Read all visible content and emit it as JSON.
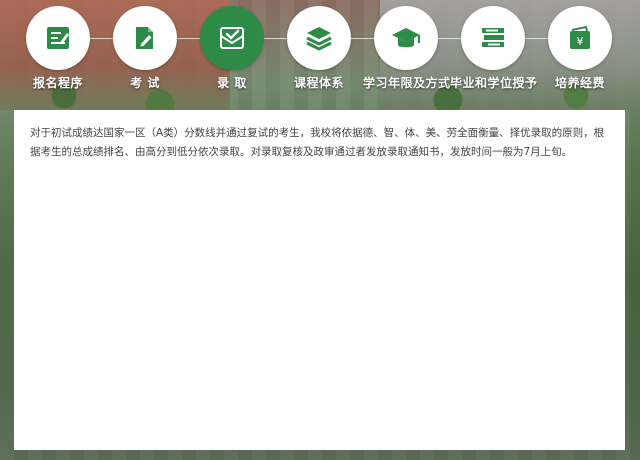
{
  "nav": {
    "items": [
      {
        "label": "报名程序",
        "icon": "form-edit-icon"
      },
      {
        "label": "考 试",
        "icon": "document-pen-icon"
      },
      {
        "label": "录 取",
        "icon": "envelope-check-icon"
      },
      {
        "label": "课程体系",
        "icon": "layers-icon"
      },
      {
        "label": "学习年限及方式",
        "icon": "graduation-cap-icon"
      },
      {
        "label": "毕业和学位授予",
        "icon": "books-icon"
      },
      {
        "label": "培养经费",
        "icon": "yuan-wallet-icon"
      }
    ],
    "active_index": 2
  },
  "colors": {
    "brand_green": "#2e8b47",
    "text": "#444444"
  },
  "content": {
    "paragraph": "对于初试成绩达国家一区（A类）分数线并通过复试的考生，我校将依据德、智、体、美、劳全面衡量、择优录取的原则，根据考生的总成绩排名、由高分到低分依次录取。对录取复核及政审通过者发放录取通知书，发放时间一般为7月上旬。"
  }
}
